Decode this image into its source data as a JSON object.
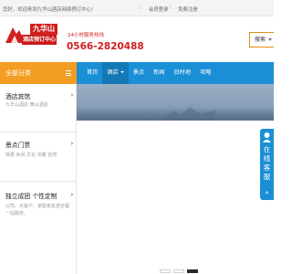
{
  "topbar": {
    "welcome": "您好，欢迎来到九华山酒店网络预订中心!",
    "member_login": "会员登录",
    "free_register": "免费注册"
  },
  "header": {
    "logo_title": "九华山",
    "logo_subtitle": "酒店预订中心",
    "service_line": "24小时服务热线",
    "phone": "0566-2820488",
    "search_label": "搜索"
  },
  "nav": {
    "category_header": "全部分类",
    "items": [
      "首页",
      "酒店",
      "景点",
      "新闻",
      "旧时地",
      "攻略"
    ]
  },
  "side_menu": [
    {
      "title": "酒店宾馆",
      "desc": "九华山酒店 黄山酒店"
    },
    {
      "title": "景点门票",
      "desc": "特惠 休闲 文化 宗教 自然"
    },
    {
      "title": "独立成团 个性定制",
      "desc": "公司、大客户、家庭亲友游全程一站服务。"
    }
  ],
  "online_service": {
    "text": "在线客服",
    "arrow": "«"
  },
  "colors": {
    "brand_red": "#d11f1f",
    "nav_blue": "#1a8fd6",
    "category_orange": "#f49d23"
  },
  "icons": {
    "logo": "mountain-logo-icon",
    "phone": "phone-icon",
    "menu": "hamburger-icon",
    "service": "person-icon"
  },
  "slider": {
    "total_slides": 3,
    "active_index": 2
  }
}
